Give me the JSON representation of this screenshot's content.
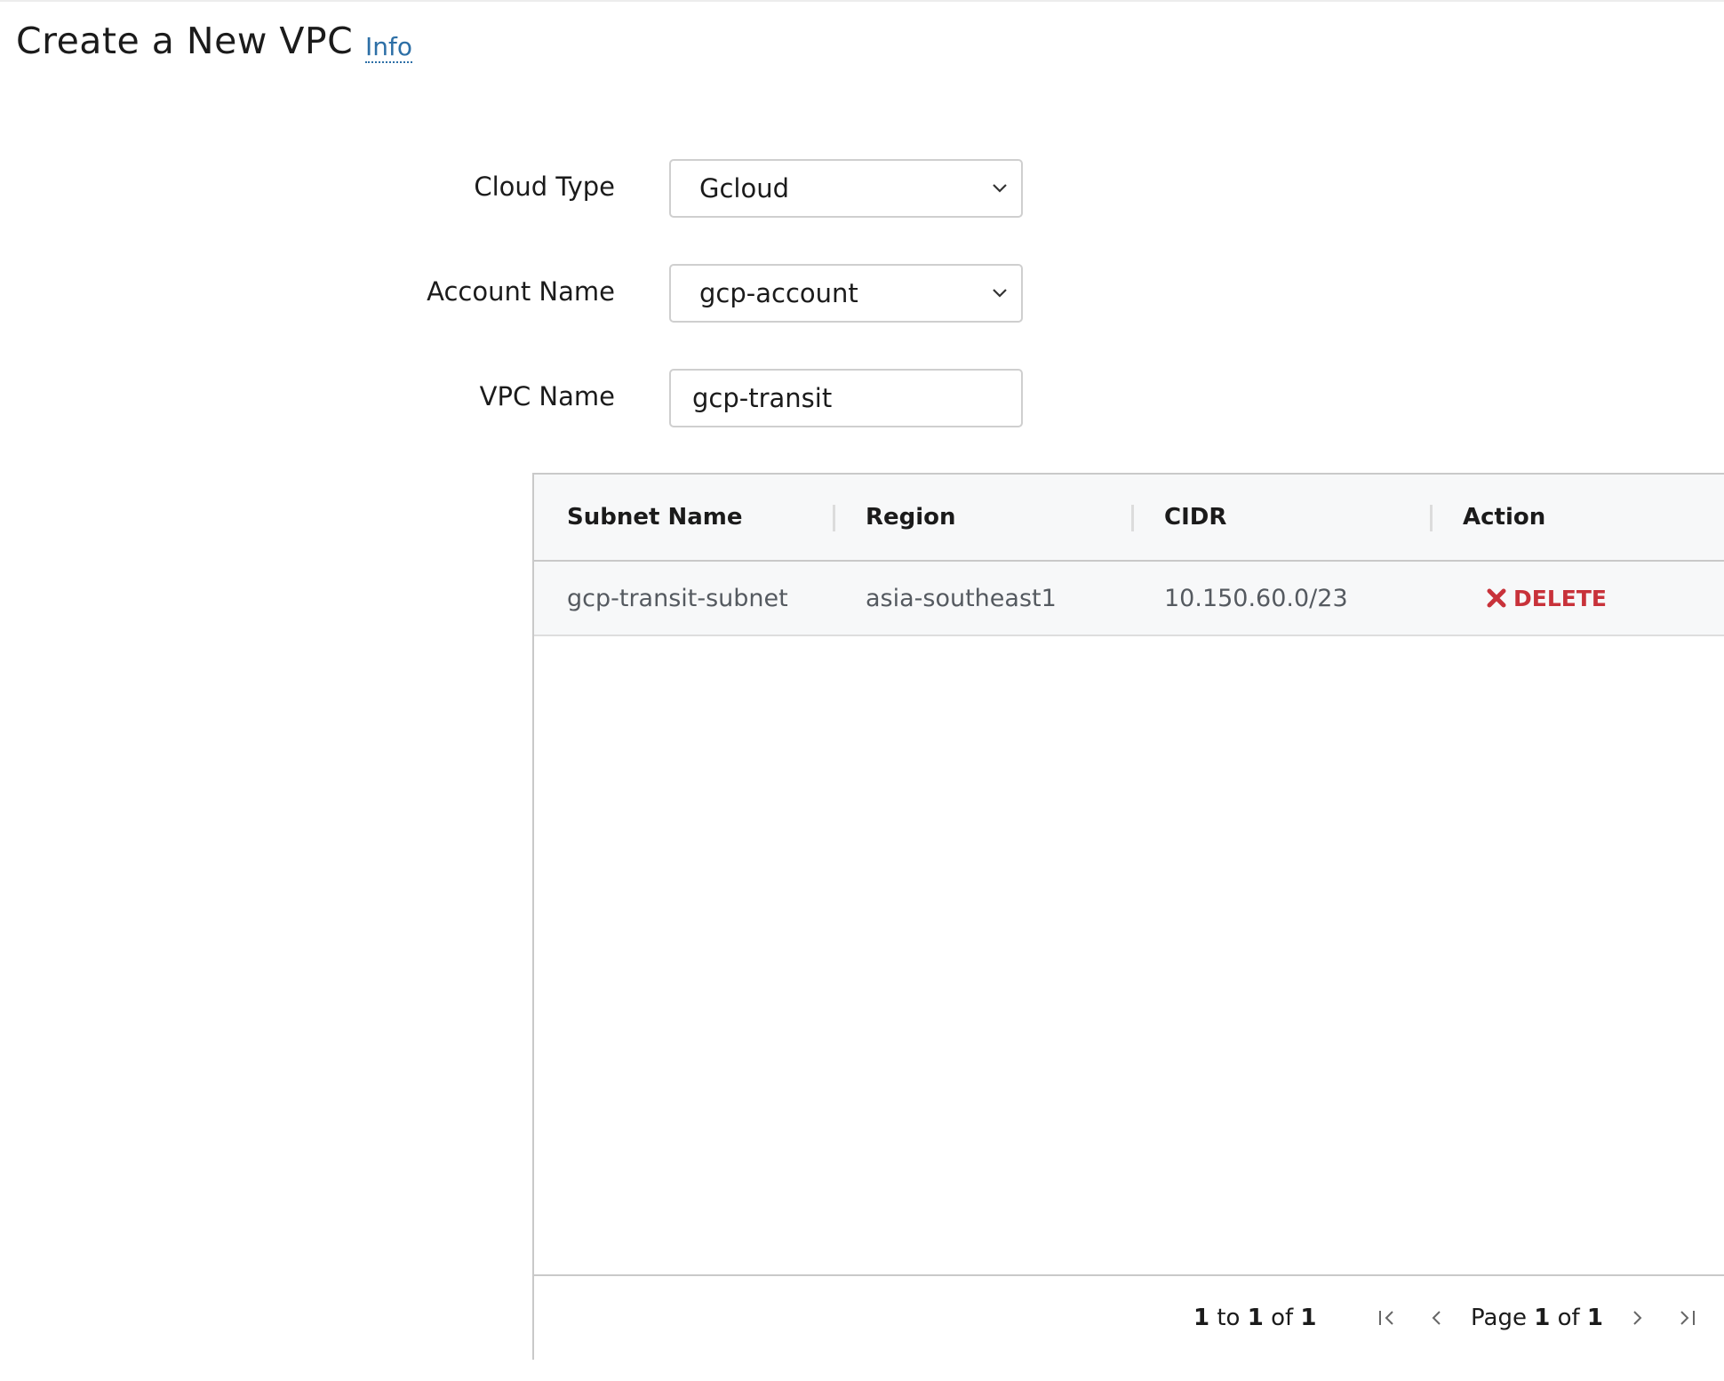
{
  "page": {
    "title": "Create a New VPC",
    "info_link": "Info"
  },
  "form": {
    "cloud_type": {
      "label": "Cloud Type",
      "value": "Gcloud"
    },
    "account_name": {
      "label": "Account Name",
      "value": "gcp-account"
    },
    "vpc_name": {
      "label": "VPC Name",
      "value": "gcp-transit"
    }
  },
  "subnets_table": {
    "columns": [
      "Subnet Name",
      "Region",
      "CIDR",
      "Action"
    ],
    "rows": [
      {
        "subnet_name": "gcp-transit-subnet",
        "region": "asia-southeast1",
        "cidr": "10.150.60.0/23",
        "action": "DELETE"
      }
    ],
    "footer": {
      "range_from": "1",
      "range_to_word": "to",
      "range_to": "1",
      "range_of_word": "of",
      "range_total": "1",
      "page_word": "Page",
      "page_current": "1",
      "page_of_word": "of",
      "page_total": "1"
    }
  },
  "colors": {
    "link": "#2d6fa6",
    "delete": "#c8323a",
    "header_bg": "#f7f8f9"
  },
  "icons": {
    "select_chevron": "chevron-down-icon",
    "delete": "close-icon",
    "first_page": "first-page-icon",
    "prev_page": "chevron-left-icon",
    "next_page": "chevron-right-icon",
    "last_page": "last-page-icon"
  }
}
